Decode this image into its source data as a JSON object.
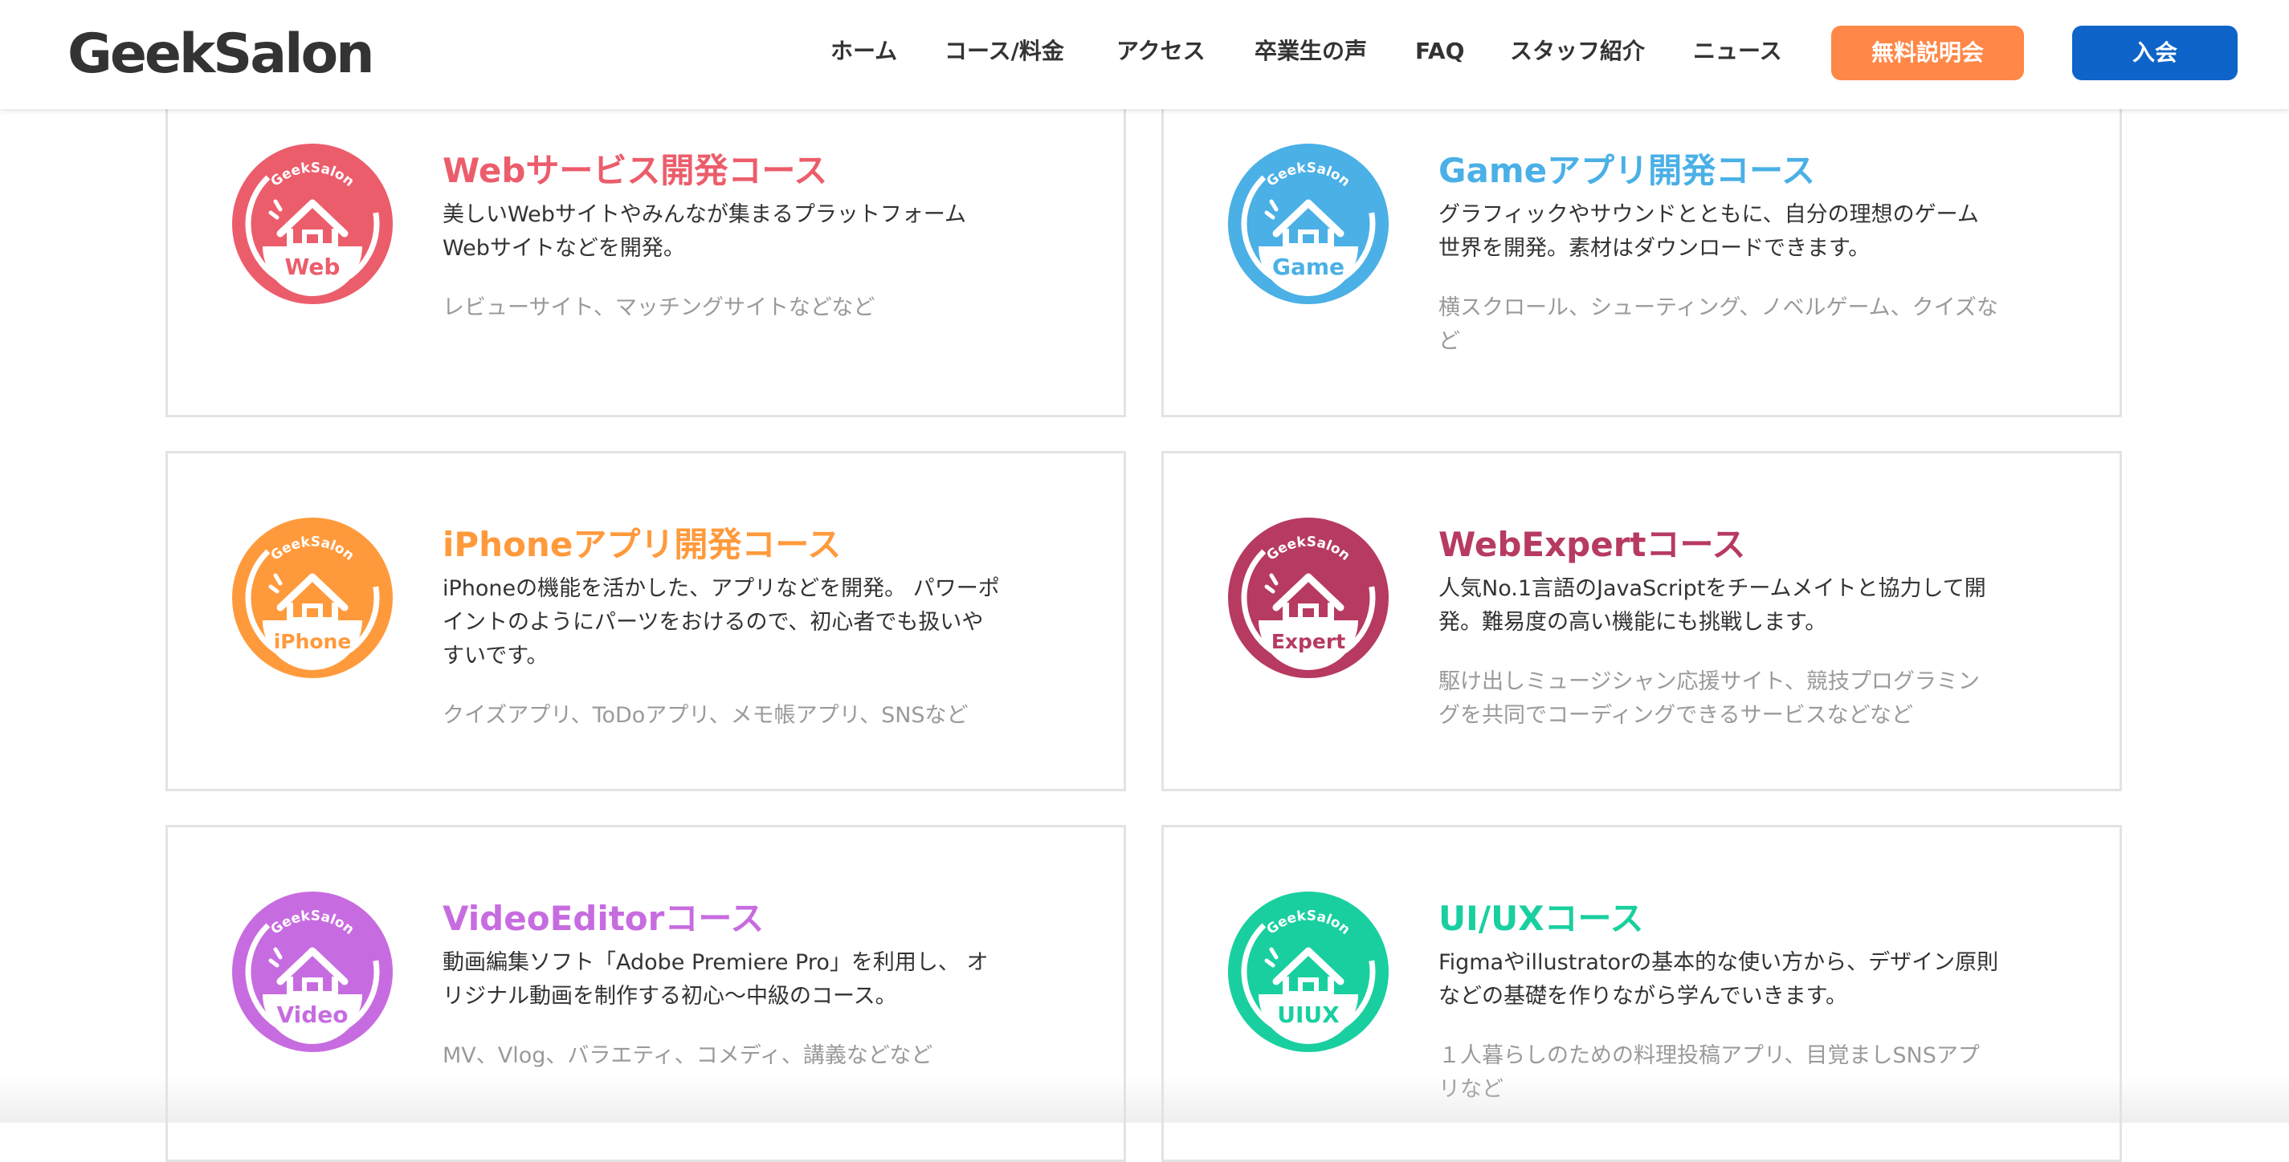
{
  "header": {
    "logo": "GeekSalon",
    "nav": [
      "ホーム",
      "コース/料金",
      "アクセス",
      "卒業生の声",
      "FAQ",
      "スタッフ紹介",
      "ニュース"
    ],
    "cta_primary": "無料説明会",
    "cta_secondary": "入会",
    "cta_primary_color": "#ff8747",
    "cta_secondary_color": "#0e64c8"
  },
  "courses": [
    {
      "badge_brand": "GeekSalon",
      "badge_label": "Web",
      "color": "#ec5d6b",
      "title": "Webサービス開発コース",
      "description": "美しいWebサイトやみんなが集まるプラットフォーム\nWebサイトなどを開発。",
      "examples": "レビューサイト、マッチングサイトなどなど"
    },
    {
      "badge_brand": "GeekSalon",
      "badge_label": "Game",
      "color": "#4ab0e6",
      "title": "Gameアプリ開発コース",
      "description": "グラフィックやサウンドとともに、自分の理想のゲーム\n世界を開発。素材はダウンロードできます。",
      "examples": "横スクロール、シューティング、ノベルゲーム、クイズな\nど"
    },
    {
      "badge_brand": "GeekSalon",
      "badge_label": "iPhone",
      "color": "#ff9a3c",
      "title": "iPhoneアプリ開発コース",
      "description": "iPhoneの機能を活かした、アプリなどを開発。 パワーポ\nイントのようにパーツをおけるので、初心者でも扱いや\nすいです。",
      "examples": "クイズアプリ、ToDoアプリ、メモ帳アプリ、SNSなど"
    },
    {
      "badge_brand": "GeekSalon",
      "badge_label": "Expert",
      "color": "#b73a60",
      "title": "WebExpertコース",
      "description": "人気No.1言語のJavaScriptをチームメイトと協力して開\n発。難易度の高い機能にも挑戦します。",
      "examples": "駆け出しミュージシャン応援サイト、競技プログラミン\nグを共同でコーディングできるサービスなどなど"
    },
    {
      "badge_brand": "GeekSalon",
      "badge_label": "Video",
      "color": "#c76ce0",
      "title": "VideoEditorコース",
      "description": "動画編集ソフト「Adobe Premiere Pro」を利用し、 オ\nリジナル動画を制作する初心～中級のコース。",
      "examples": "MV、Vlog、バラエティ、コメディ、講義などなど"
    },
    {
      "badge_brand": "GeekSalon",
      "badge_label": "UIUX",
      "color": "#19cfa0",
      "title": "UI/UXコース",
      "description": "Figmaやillustratorの基本的な使い方から、デザイン原則\nなどの基礎を作りながら学んでいきます。",
      "examples": "１人暮らしのための料理投稿アプリ、目覚ましSNSアプ\nリなど"
    }
  ]
}
